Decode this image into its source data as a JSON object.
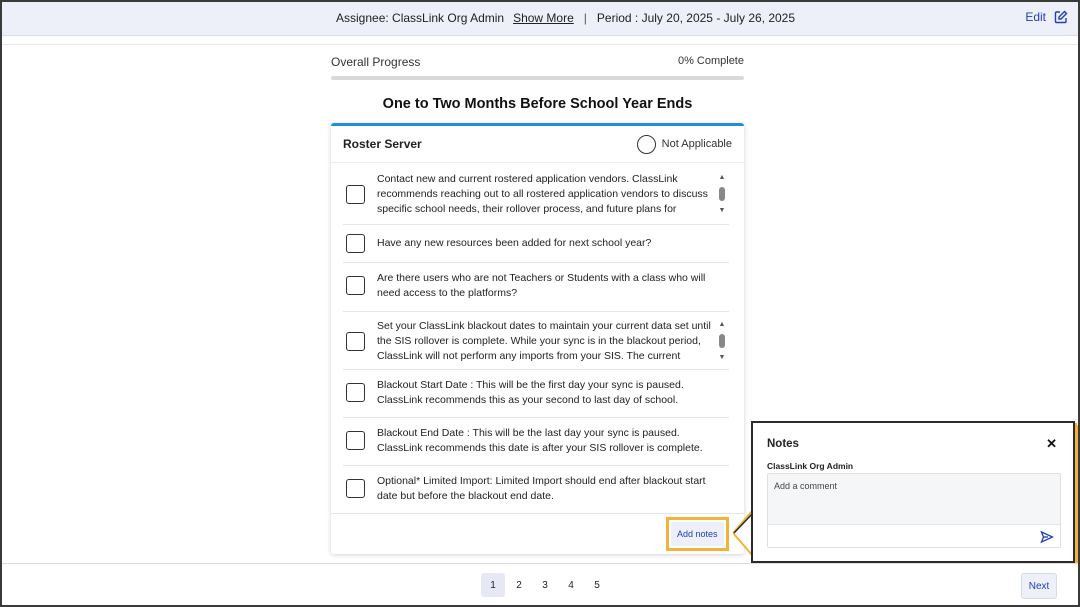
{
  "header": {
    "assignee": "Assignee: ClassLink Org Admin",
    "show_more": "Show More",
    "separator": "|",
    "period": "Period : July 20, 2025 - July 26, 2025",
    "edit_label": "Edit",
    "edit_icon": "edit-pencil-icon"
  },
  "progress": {
    "label": "Overall Progress",
    "complete_text": "0% Complete",
    "percent": 0,
    "accent_color": "#1f73c8"
  },
  "section": {
    "title": "One to Two Months Before School Year Ends"
  },
  "card": {
    "title": "Roster Server",
    "not_applicable": "Not Applicable",
    "accent_color": "#1f8fd6",
    "tasks": [
      {
        "text": "Contact new and current rostered application vendors. ClassLink recommends reaching out to all rostered application vendors to discuss specific school needs, their rollover process, and future plans for",
        "checked": false,
        "scrollable": true
      },
      {
        "text": "Have any new resources been added for next school year?",
        "checked": false,
        "scrollable": false
      },
      {
        "text": "Are there users who are not Teachers or Students with a class who will need access to the platforms?",
        "checked": false,
        "scrollable": false
      },
      {
        "text": "Set your ClassLink blackout dates to maintain your current data set until the SIS rollover is complete. While your sync is in the blackout period, ClassLink will not perform any imports from your SIS. The current school",
        "checked": false,
        "scrollable": true
      },
      {
        "text": "Blackout Start Date : This will be the first day your sync is paused. ClassLink recommends this as your second to last day of school.",
        "checked": false,
        "scrollable": false
      },
      {
        "text": "Blackout End Date : This will be the last day your sync is paused. ClassLink recommends this date is after your SIS rollover is complete.",
        "checked": false,
        "scrollable": false
      },
      {
        "text": "Optional* Limited Import: Limited Import should end after blackout start date but before the blackout end date.",
        "checked": false,
        "scrollable": false
      }
    ],
    "add_notes": "Add notes",
    "highlight_color": "#f2b33a"
  },
  "notes": {
    "title": "Notes",
    "close_icon": "close-icon",
    "user": "ClassLink Org Admin",
    "placeholder": "Add a comment",
    "value": "",
    "send_icon": "send-icon"
  },
  "pagination": {
    "pages": [
      "1",
      "2",
      "3",
      "4",
      "5"
    ],
    "current": "1",
    "next": "Next"
  }
}
